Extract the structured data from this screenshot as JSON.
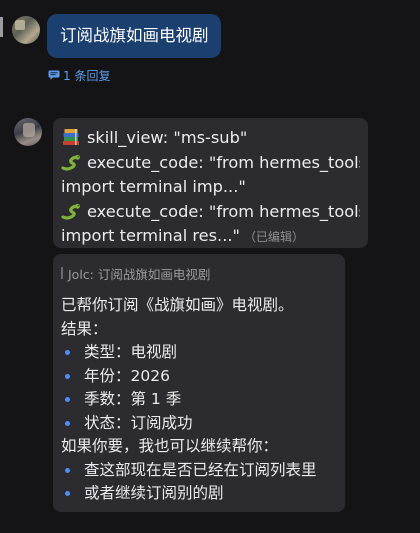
{
  "messages": [
    {
      "text": "订阅战旗如画电视剧",
      "bubble_color": "#1b3f6e",
      "thread": {
        "label": "1 条回复",
        "icon": "comment-icon",
        "color": "#5a9bea"
      }
    },
    {
      "lines": [
        {
          "icon": "books-icon",
          "text": "skill_view: \"ms-sub\""
        },
        {
          "icon": "snake-icon",
          "text": "execute_code: \"from hermes_tools"
        },
        {
          "icon": "",
          "text": "import terminal imp...\""
        },
        {
          "icon": "snake-icon",
          "text": "execute_code: \"from hermes_tools"
        },
        {
          "icon": "",
          "text": "import terminal res...\""
        }
      ],
      "edited_label": "（已编辑）"
    },
    {
      "quote": "Jolc: 订阅战旗如画电视剧",
      "intro": "已帮你订阅《战旗如画》电视剧。",
      "result_heading": "结果：",
      "results": [
        "类型：电视剧",
        "年份：2026",
        "季数：第 1 季",
        "状态：订阅成功"
      ],
      "followup_heading": "如果你要，我也可以继续帮你：",
      "followups": [
        "查这部现在是否已经在订阅列表里",
        "或者继续订阅别的剧"
      ],
      "bullet_color": "#4f8ff0"
    }
  ]
}
